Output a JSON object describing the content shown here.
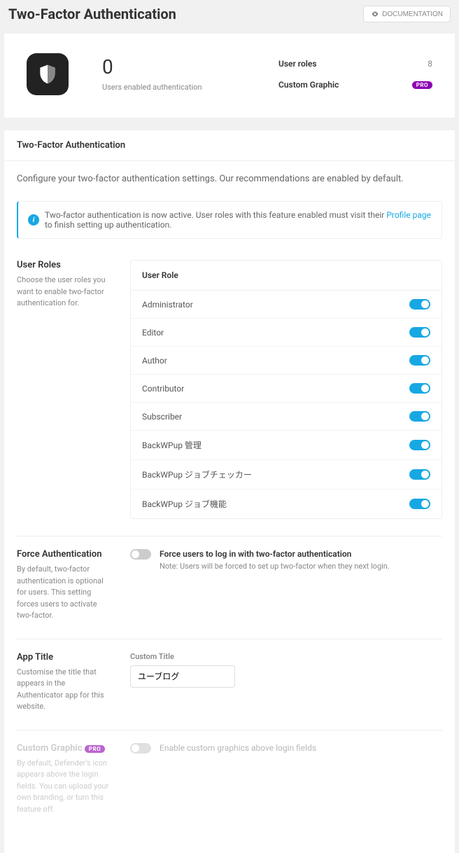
{
  "header": {
    "title": "Two-Factor Authentication",
    "doc_button": "DOCUMENTATION"
  },
  "summary": {
    "stat_num": "0",
    "stat_label": "Users enabled authentication",
    "meta": [
      {
        "label": "User roles",
        "value": "8"
      },
      {
        "label": "Custom Graphic",
        "badge": "PRO"
      }
    ]
  },
  "panel": {
    "title": "Two-Factor Authentication",
    "desc": "Configure your two-factor authentication settings. Our recommendations are enabled by default.",
    "notice_before": "Two-factor authentication is now active. User roles with this feature enabled must visit their ",
    "notice_link": "Profile page",
    "notice_after": " to finish setting up authentication."
  },
  "user_roles": {
    "title": "User Roles",
    "desc": "Choose the user roles you want to enable two-factor authentication for.",
    "header": "User Role",
    "roles": [
      {
        "name": "Administrator",
        "on": true
      },
      {
        "name": "Editor",
        "on": true
      },
      {
        "name": "Author",
        "on": true
      },
      {
        "name": "Contributor",
        "on": true
      },
      {
        "name": "Subscriber",
        "on": true
      },
      {
        "name": "BackWPup 管理",
        "on": true
      },
      {
        "name": "BackWPup ジョブチェッカー",
        "on": true
      },
      {
        "name": "BackWPup ジョブ機能",
        "on": true
      }
    ]
  },
  "force": {
    "title": "Force Authentication",
    "desc": "By default, two-factor authentication is optional for users. This setting forces users to activate two-factor.",
    "label": "Force users to log in with two-factor authentication",
    "note": "Note: Users will be forced to set up two-factor when they next login."
  },
  "apptitle": {
    "title": "App Title",
    "desc": "Customise the title that appears in the Authenticator app for this website.",
    "field_label": "Custom Title",
    "value": "ユーブログ"
  },
  "custom_graphic": {
    "title": "Custom Graphic",
    "badge": "PRO",
    "desc": "By default, Defender's icon appears above the login fields. You can upload your own branding, or turn this feature off.",
    "label": "Enable custom graphics above login fields"
  }
}
